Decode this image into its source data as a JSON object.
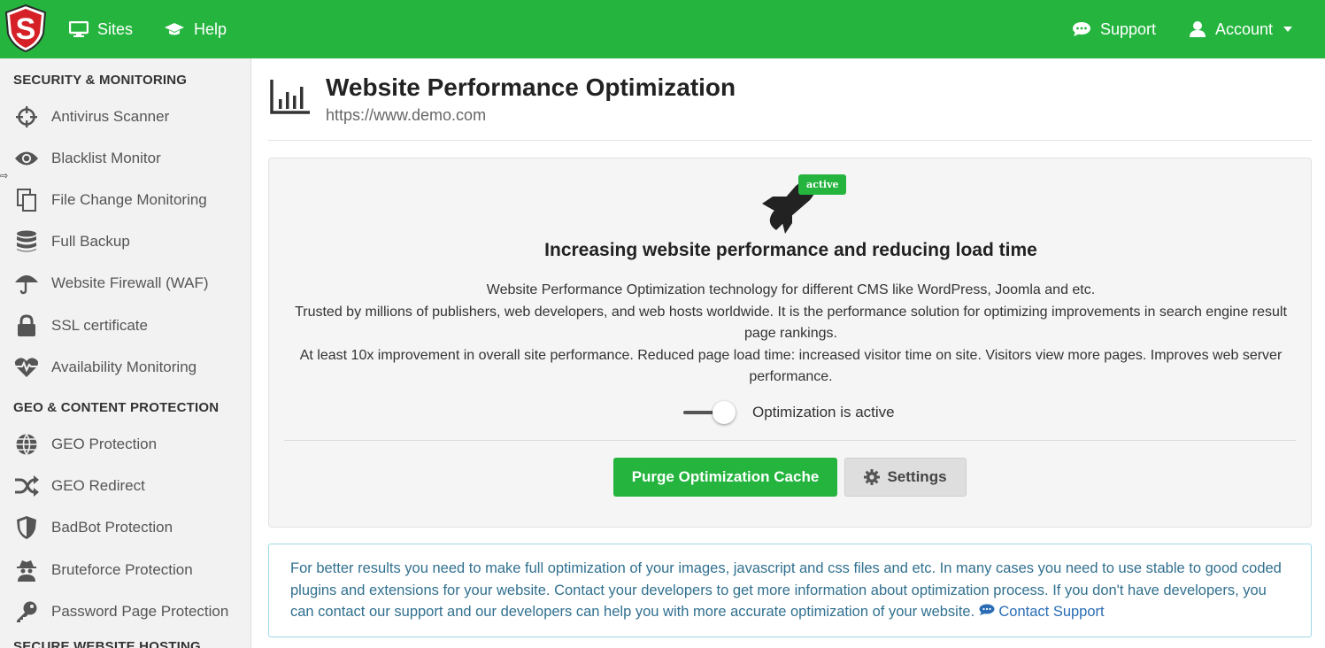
{
  "header": {
    "nav": [
      {
        "label": "Sites",
        "icon": "monitor-icon"
      },
      {
        "label": "Help",
        "icon": "graduation-cap-icon"
      }
    ],
    "support_label": "Support",
    "account_label": "Account",
    "brand_color": "#25b53f"
  },
  "sidebar": {
    "section1": "SECURITY & MONITORING",
    "items1": [
      {
        "label": "Antivirus Scanner",
        "icon": "crosshairs-icon"
      },
      {
        "label": "Blacklist Monitor",
        "icon": "eye-icon"
      },
      {
        "label": "File Change Monitoring",
        "icon": "files-icon"
      },
      {
        "label": "Full Backup",
        "icon": "database-icon"
      },
      {
        "label": "Website Firewall (WAF)",
        "icon": "umbrella-icon"
      },
      {
        "label": "SSL certificate",
        "icon": "lock-icon"
      },
      {
        "label": "Availability Monitoring",
        "icon": "heartbeat-icon"
      }
    ],
    "section2": "GEO & CONTENT PROTECTION",
    "items2": [
      {
        "label": "GEO Protection",
        "icon": "globe-icon"
      },
      {
        "label": "GEO Redirect",
        "icon": "shuffle-icon"
      },
      {
        "label": "BadBot Protection",
        "icon": "shield-icon"
      },
      {
        "label": "Bruteforce Protection",
        "icon": "spy-icon"
      },
      {
        "label": "Password Page Protection",
        "icon": "key-icon"
      }
    ],
    "section3": "SECURE WEBSITE HOSTING"
  },
  "main": {
    "title": "Website Performance Optimization",
    "url": "https://www.demo.com",
    "badge": "active",
    "panel_title": "Increasing website performance and reducing load time",
    "desc_line1": "Website Performance Optimization technology for different CMS like WordPress, Joomla and etc.",
    "desc_line2": "Trusted by millions of publishers, web developers, and web hosts worldwide. It is the performance solution for optimizing improvements in search engine result page rankings.",
    "desc_line3": "At least 10x improvement in overall site performance. Reduced page load time: increased visitor time on site. Visitors view more pages. Improves web server performance.",
    "toggle_label": "Optimization is active",
    "purge_label": "Purge Optimization Cache",
    "settings_label": "Settings",
    "info_text": "For better results you need to make full optimization of your images, javascript and css files and etc. In many cases you need to use stable to good coded plugins and extensions for your website. Contact your developers to get more information about optimization process. If you don't have developers, you can contact our support and our developers can help you with more accurate optimization of your website.",
    "contact_label": "Contact Support"
  }
}
